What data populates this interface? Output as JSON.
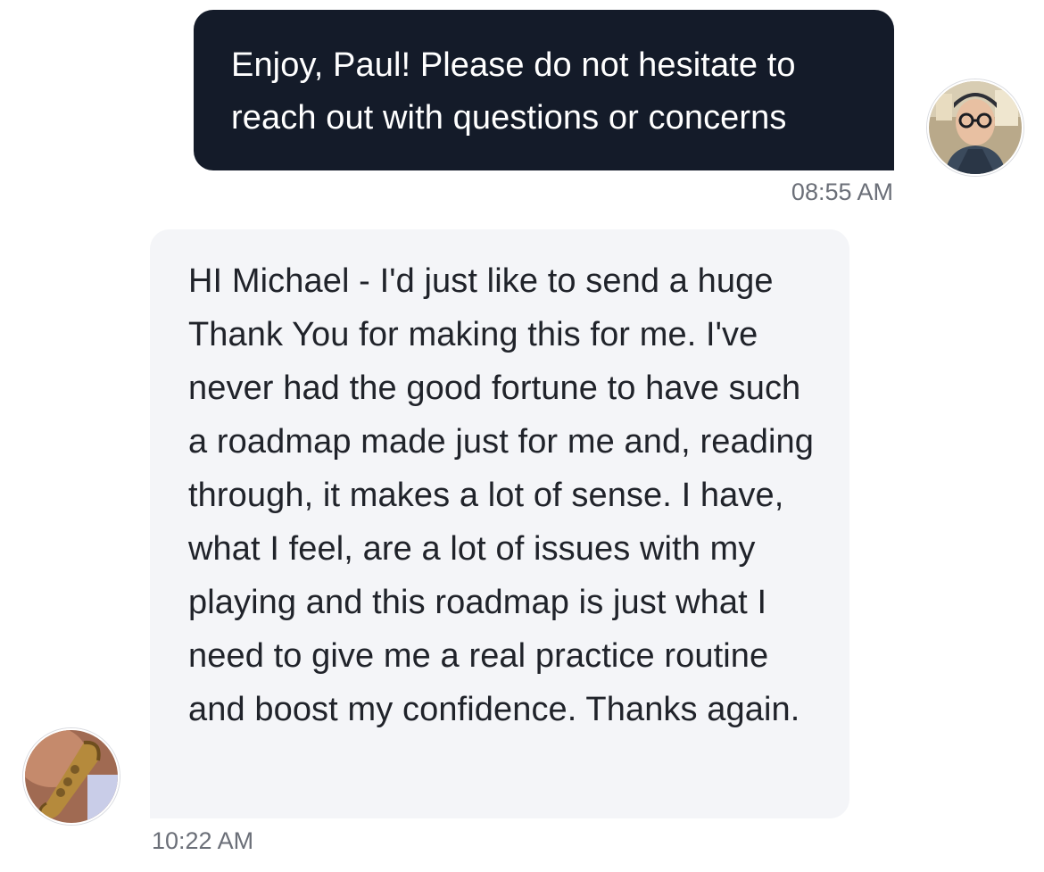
{
  "messages": [
    {
      "direction": "outgoing",
      "text": "Enjoy, Paul! Please do not hesitate to reach out with questions or concerns",
      "time": "08:55 AM",
      "avatar_icon": "agent-avatar-photo"
    },
    {
      "direction": "incoming",
      "text": "HI Michael - I'd just like to send a huge Thank You for making this for me. I've never had the good fortune to have such a roadmap made just for me and, reading through, it makes a lot of sense. I have, what I feel, are a lot of issues with my playing and this roadmap is just what I need to give me a real practice routine and boost my confidence. Thanks again.",
      "time": "10:22 AM",
      "avatar_icon": "saxophone-avatar-photo"
    }
  ],
  "colors": {
    "outgoing_bubble": "#141b29",
    "incoming_bubble": "#f4f5f8",
    "timestamp": "#6b6f78"
  }
}
